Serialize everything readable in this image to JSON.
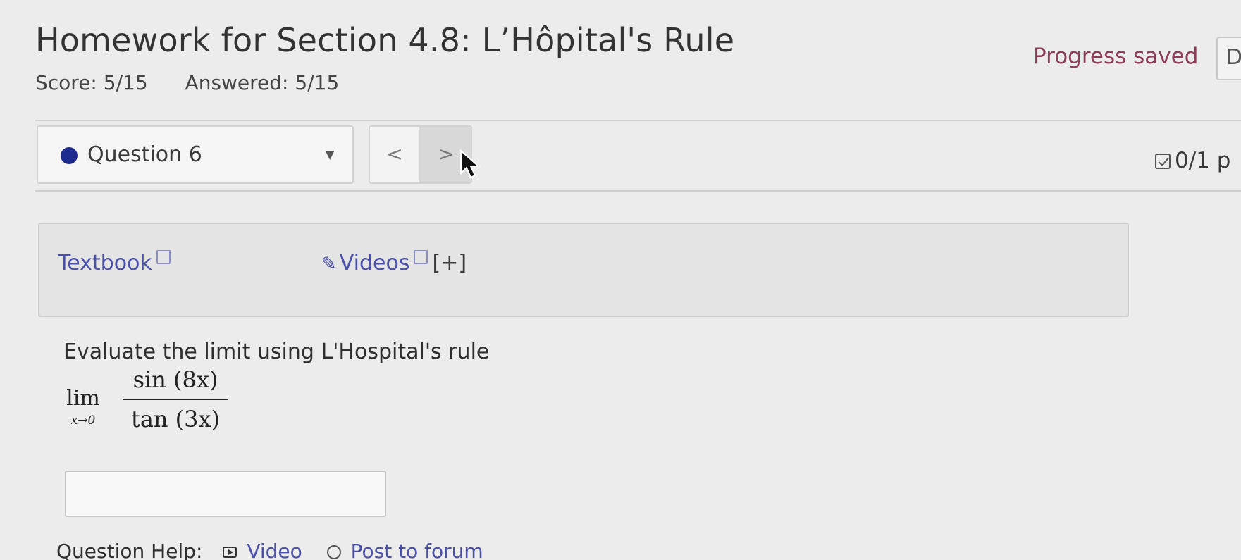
{
  "header": {
    "title": "Homework for Section 4.8: L’Hôpital's Rule",
    "score": "Score: 5/15",
    "answered": "Answered: 5/15",
    "progress_status": "Progress saved",
    "top_right_button_label": "D"
  },
  "question_nav": {
    "selected_question": "Question 6",
    "prev_label": "<",
    "next_label": ">",
    "points": "0/1 p"
  },
  "resources": {
    "textbook_label": "Textbook",
    "videos_label": "Videos",
    "expand_label": "[+]"
  },
  "question": {
    "prompt": "Evaluate the limit using L'Hospital's rule",
    "limit_word": "lim",
    "limit_subscript": "x→0",
    "numerator": "sin (8x)",
    "denominator": "tan (3x)",
    "answer_value": ""
  },
  "help": {
    "label": "Question Help:",
    "video_label": "Video",
    "forum_label": "Post to forum"
  }
}
